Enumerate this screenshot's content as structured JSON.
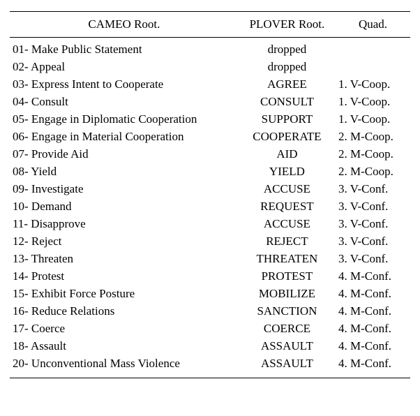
{
  "table": {
    "headers": {
      "cameo": "CAMEO Root.",
      "plover": "PLOVER Root.",
      "quad": "Quad."
    },
    "rows": [
      {
        "cameo": "01- Make Public Statement",
        "plover": "dropped",
        "quad": ""
      },
      {
        "cameo": "02- Appeal",
        "plover": "dropped",
        "quad": ""
      },
      {
        "cameo": "03- Express Intent to Cooperate",
        "plover": "AGREE",
        "quad": "1. V-Coop."
      },
      {
        "cameo": "04- Consult",
        "plover": "CONSULT",
        "quad": "1. V-Coop."
      },
      {
        "cameo": "05- Engage in Diplomatic Cooperation",
        "plover": "SUPPORT",
        "quad": "1. V-Coop."
      },
      {
        "cameo": "06- Engage in Material Cooperation",
        "plover": "COOPERATE",
        "quad": "2. M-Coop."
      },
      {
        "cameo": "07- Provide Aid",
        "plover": "AID",
        "quad": "2. M-Coop."
      },
      {
        "cameo": "08- Yield",
        "plover": "YIELD",
        "quad": "2. M-Coop."
      },
      {
        "cameo": "09- Investigate",
        "plover": "ACCUSE",
        "quad": "3. V-Conf."
      },
      {
        "cameo": "10- Demand",
        "plover": "REQUEST",
        "quad": "3. V-Conf."
      },
      {
        "cameo": "11- Disapprove",
        "plover": "ACCUSE",
        "quad": "3. V-Conf."
      },
      {
        "cameo": "12- Reject",
        "plover": "REJECT",
        "quad": "3. V-Conf."
      },
      {
        "cameo": "13- Threaten",
        "plover": "THREATEN",
        "quad": "3. V-Conf."
      },
      {
        "cameo": "14- Protest",
        "plover": "PROTEST",
        "quad": "4. M-Conf."
      },
      {
        "cameo": "15- Exhibit Force Posture",
        "plover": "MOBILIZE",
        "quad": "4. M-Conf."
      },
      {
        "cameo": "16- Reduce Relations",
        "plover": "SANCTION",
        "quad": "4. M-Conf."
      },
      {
        "cameo": "17- Coerce",
        "plover": "COERCE",
        "quad": "4. M-Conf."
      },
      {
        "cameo": "18- Assault",
        "plover": "ASSAULT",
        "quad": "4. M-Conf."
      },
      {
        "cameo": "20- Unconventional Mass Violence",
        "plover": "ASSAULT",
        "quad": "4. M-Conf."
      }
    ]
  }
}
